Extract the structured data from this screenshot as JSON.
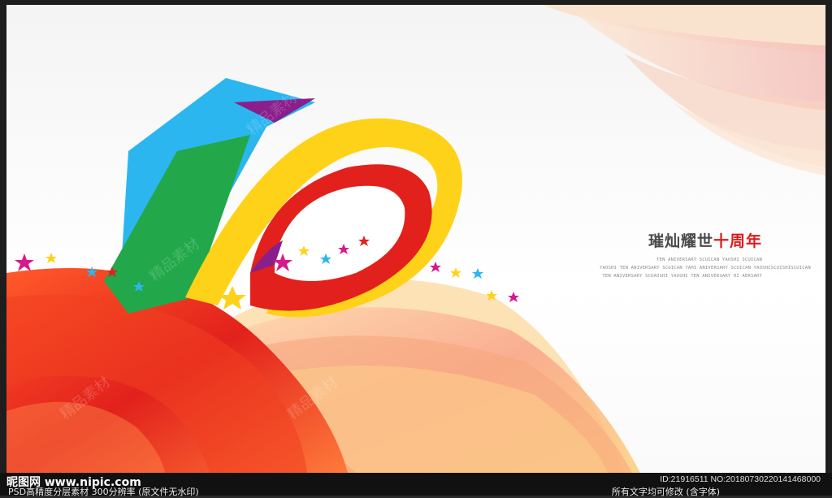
{
  "artwork": {
    "numeral": "10",
    "title_main": "璀灿耀世",
    "title_accent": "十周年",
    "subtitle_lines": [
      "TEN ANIVERSARY SCUICAN YAOSHI SCUICAN",
      "YAOSHI TEN ANIVERSARY SCUICAN YAHI  ANIVERSARY SCUICAN YAOSHISCUISHISCUICAN",
      "TEN ANIVERSARY SCUAOSHI  YAOSHI TEN ANIVERSARY HI  AERSARY"
    ],
    "watermark": "精品素材",
    "colors": {
      "blue": "#2bb6f0",
      "green": "#22a84a",
      "yellow": "#ffd21a",
      "red": "#e2211c",
      "purple": "#8a1f8c",
      "peach": "#f7c9a0"
    }
  },
  "footer": {
    "brand": "昵图网 www.nipic.com",
    "description": "PSD高精度分层素材 300分辨率 (原文件无水印)",
    "id_text": "ID:21916511 NO:20180730220141468000",
    "note": "所有文字均可修改 (含字体)"
  }
}
